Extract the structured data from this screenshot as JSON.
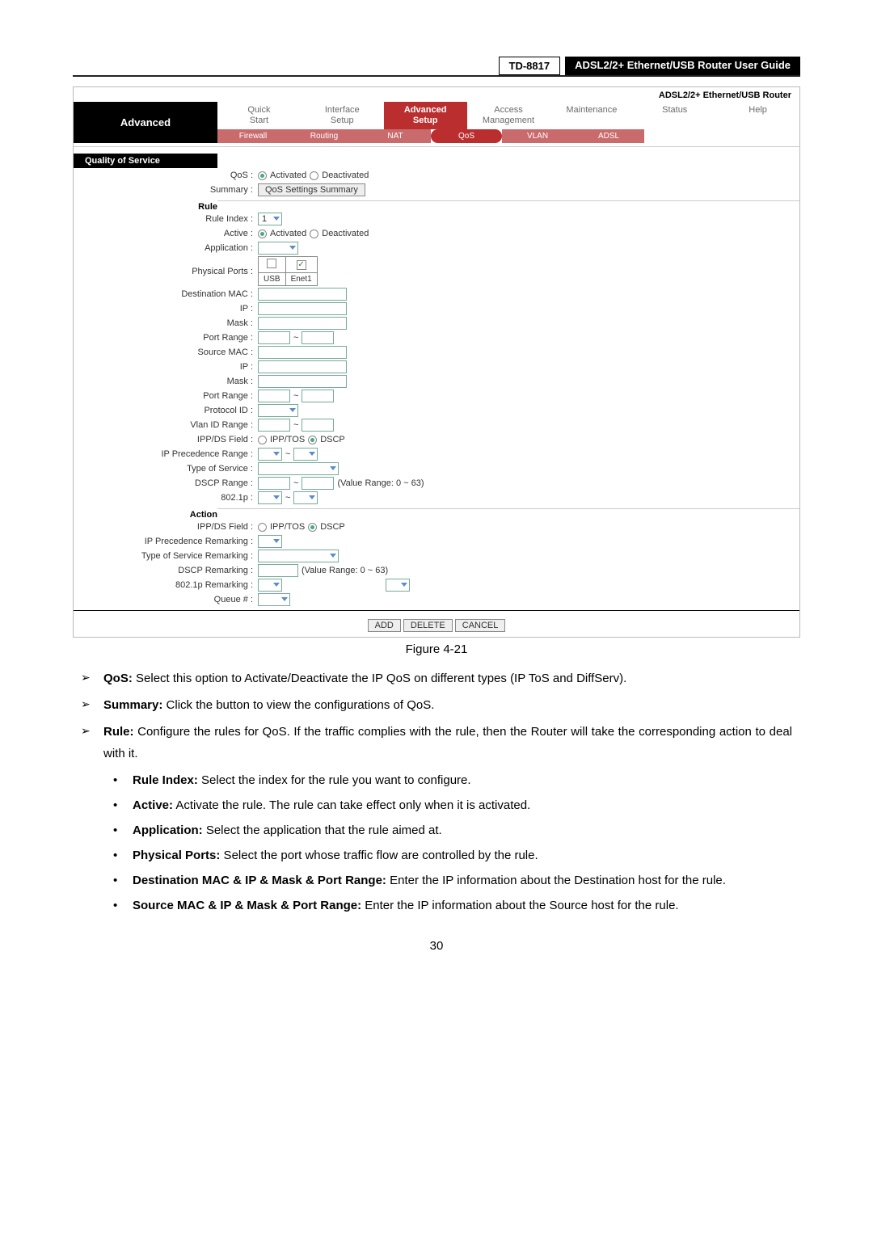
{
  "header": {
    "model": "TD-8817",
    "title": "ADSL2/2+  Ethernet/USB  Router  User  Guide"
  },
  "router_label": "ADSL2/2+ Ethernet/USB Router",
  "nav": {
    "advanced": "Advanced",
    "row1": [
      "Quick\nStart",
      "Interface\nSetup",
      "Advanced\nSetup",
      "Access\nManagement",
      "Maintenance",
      "Status",
      "Help"
    ],
    "row2": [
      "Firewall",
      "Routing",
      "NAT",
      "QoS",
      "VLAN",
      "ADSL"
    ]
  },
  "bars": {
    "qos": "Quality of Service",
    "rule": "Rule",
    "action": "Action"
  },
  "labels": {
    "qos": "QoS :",
    "summary": "Summary :",
    "ruleidx": "Rule Index :",
    "active": "Active :",
    "app": "Application :",
    "pports": "Physical Ports :",
    "dmac": "Destination MAC :",
    "ip": "IP :",
    "mask": "Mask :",
    "prange": "Port Range :",
    "smac": "Source MAC :",
    "proto": "Protocol ID :",
    "vlan": "Vlan ID Range :",
    "ippds": "IPP/DS Field :",
    "ipprec": "IP Precedence Range :",
    "tos": "Type of Service :",
    "dscp": "DSCP Range :",
    "802": "802.1p :",
    "ipprecr": "IP Precedence Remarking :",
    "tosr": "Type of Service Remarking :",
    "dscpr": "DSCP Remarking :",
    "802r": "802.1p Remarking :",
    "queue": "Queue # :"
  },
  "radios": {
    "act": "Activated",
    "deact": "Deactivated",
    "ipptos": "IPP/TOS",
    "dscp": "DSCP"
  },
  "ports": {
    "usb": "USB",
    "enet": "Enet1"
  },
  "btns": {
    "sum": "QoS Settings Summary",
    "add": "ADD",
    "del": "DELETE",
    "cancel": "CANCEL"
  },
  "misc": {
    "valrange": "(Value Range: 0 ~ 63)",
    "one": "1",
    "tilde": "~"
  },
  "caption": "Figure 4-21",
  "bullets": {
    "b1": {
      "l": "QoS:",
      "t": " Select this option to Activate/Deactivate the IP QoS on different types (IP ToS and DiffServ)."
    },
    "b2": {
      "l": "Summary:",
      "t": " Click the button to view the configurations of QoS."
    },
    "b3": {
      "l": "Rule:",
      "t": " Configure the rules for QoS. If the traffic complies with the rule, then the Router will take the corresponding action to deal with it."
    },
    "s1": {
      "l": "Rule Index:",
      "t": " Select the index for the rule you want to configure."
    },
    "s2": {
      "l": "Active:",
      "t": " Activate the rule. The rule can take effect only when it is activated."
    },
    "s3": {
      "l": "Application:",
      "t": " Select the application that the rule aimed at."
    },
    "s4": {
      "l": "Physical Ports:",
      "t": " Select the port whose traffic flow are controlled by the rule."
    },
    "s5": {
      "l": "Destination MAC & IP & Mask & Port Range:",
      "t": " Enter the IP information about the Destination host for the rule."
    },
    "s6": {
      "l": "Source MAC & IP & Mask & Port Range:",
      "t": " Enter the IP information about the Source host for the rule."
    }
  },
  "pagenum": "30"
}
